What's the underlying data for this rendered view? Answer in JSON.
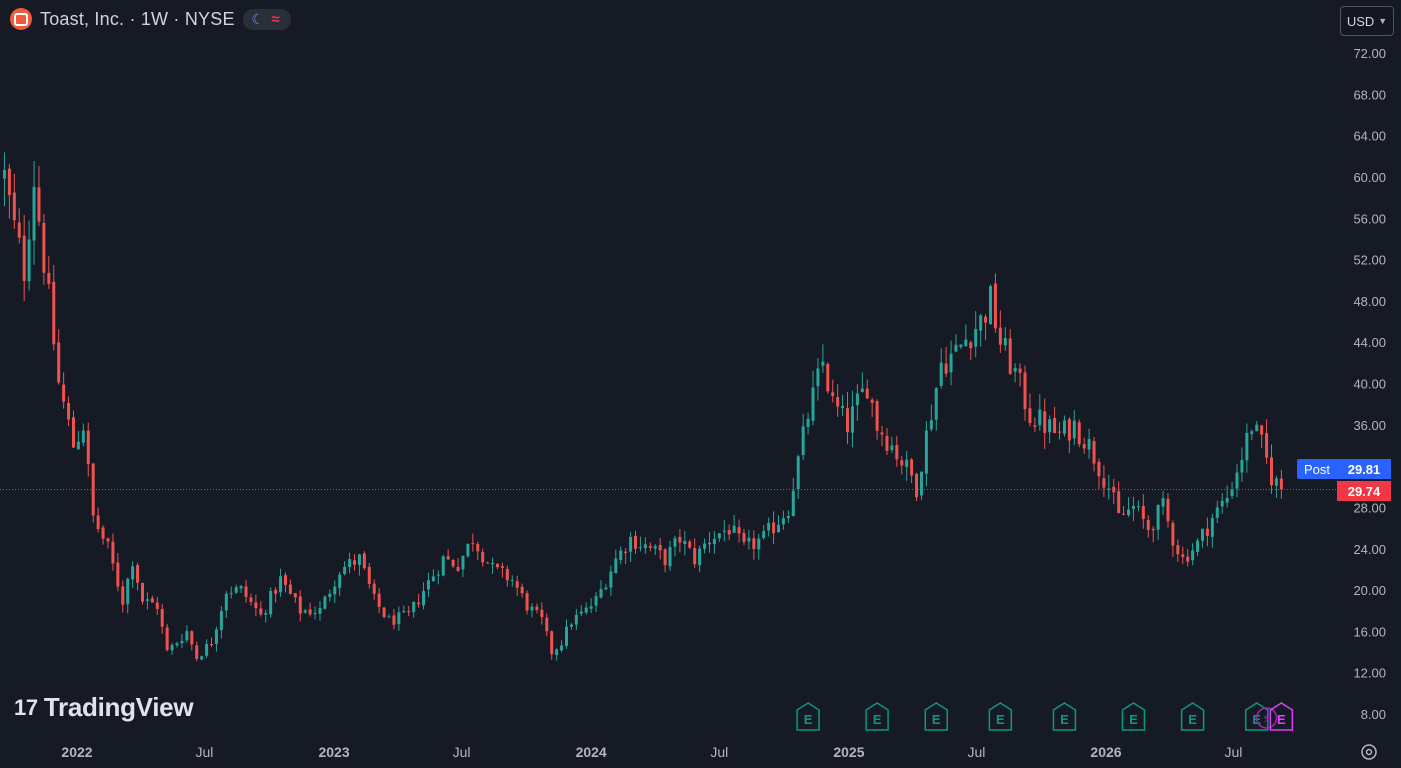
{
  "header": {
    "title": "Toast, Inc. · 1W · NYSE",
    "logo_icon": "toast-logo-icon",
    "moon_icon": "moon-icon",
    "wave_icon": "wave-icon"
  },
  "currency": {
    "label": "USD",
    "chevron_icon": "chevron-down-icon"
  },
  "price_labels": {
    "post_label": "Post",
    "post_value": "29.81",
    "last_value": "29.74"
  },
  "watermark": {
    "text": "TradingView",
    "logo_glyph": "17"
  },
  "colors": {
    "background": "#161a25",
    "up": "#26a69a",
    "down": "#ef5350",
    "post": "#2962ff",
    "last": "#f23645",
    "earnings": "#089981",
    "split": "#9c27b0",
    "dividend": "#e040fb"
  },
  "chart_data": {
    "type": "candlestick",
    "timeframe": "1W",
    "y_axis": {
      "min": 8,
      "max": 72,
      "ticks": [
        8,
        12,
        16,
        20,
        24,
        28,
        32,
        36,
        40,
        44,
        48,
        52,
        56,
        60,
        64,
        68,
        72
      ],
      "tick_labels": [
        "8.00",
        "12.00",
        "16.00",
        "20.00",
        "24.00",
        "28.00",
        "",
        "36.00",
        "40.00",
        "44.00",
        "48.00",
        "52.00",
        "56.00",
        "60.00",
        "64.00",
        "68.00",
        "72.00"
      ]
    },
    "x_axis": {
      "labels": [
        "2022",
        "Jul",
        "2023",
        "Jul",
        "2024",
        "Jul",
        "2025",
        "Jul",
        "2026",
        "Jul"
      ],
      "start": "2021-09-20",
      "end": "2026-09-14"
    },
    "last_price": 29.74,
    "post_price": 29.81,
    "anchors": [
      [
        "2021-09-20",
        60
      ],
      [
        "2021-10-04",
        55
      ],
      [
        "2021-10-18",
        51
      ],
      [
        "2021-11-01",
        60
      ],
      [
        "2021-11-15",
        52
      ],
      [
        "2021-12-06",
        40
      ],
      [
        "2021-12-27",
        34
      ],
      [
        "2022-01-10",
        36
      ],
      [
        "2022-01-24",
        27
      ],
      [
        "2022-02-14",
        24
      ],
      [
        "2022-03-07",
        19
      ],
      [
        "2022-03-21",
        23
      ],
      [
        "2022-04-04",
        19
      ],
      [
        "2022-04-25",
        18.5
      ],
      [
        "2022-05-09",
        14
      ],
      [
        "2022-05-23",
        15
      ],
      [
        "2022-06-06",
        16
      ],
      [
        "2022-06-20",
        13.5
      ],
      [
        "2022-07-11",
        15
      ],
      [
        "2022-08-01",
        20
      ],
      [
        "2022-08-22",
        20
      ],
      [
        "2022-09-19",
        17.5
      ],
      [
        "2022-10-17",
        21
      ],
      [
        "2022-11-14",
        18
      ],
      [
        "2022-12-12",
        18
      ],
      [
        "2023-01-09",
        22
      ],
      [
        "2023-02-06",
        23
      ],
      [
        "2023-02-27",
        19
      ],
      [
        "2023-03-20",
        17
      ],
      [
        "2023-04-17",
        17.5
      ],
      [
        "2023-05-08",
        20
      ],
      [
        "2023-06-05",
        23
      ],
      [
        "2023-06-26",
        22.5
      ],
      [
        "2023-07-17",
        25
      ],
      [
        "2023-08-14",
        22
      ],
      [
        "2023-09-11",
        21
      ],
      [
        "2023-10-02",
        18.5
      ],
      [
        "2023-10-23",
        17
      ],
      [
        "2023-11-06",
        14
      ],
      [
        "2023-11-20",
        15
      ],
      [
        "2023-12-04",
        17
      ],
      [
        "2023-12-25",
        18
      ],
      [
        "2024-01-08",
        19
      ],
      [
        "2024-02-05",
        23
      ],
      [
        "2024-02-26",
        25
      ],
      [
        "2024-03-25",
        24
      ],
      [
        "2024-04-15",
        23
      ],
      [
        "2024-05-06",
        25
      ],
      [
        "2024-05-27",
        23
      ],
      [
        "2024-06-17",
        25
      ],
      [
        "2024-07-15",
        26
      ],
      [
        "2024-08-05",
        24
      ],
      [
        "2024-09-02",
        25
      ],
      [
        "2024-10-07",
        28
      ],
      [
        "2024-11-04",
        37
      ],
      [
        "2024-11-25",
        42
      ],
      [
        "2024-12-09",
        38
      ],
      [
        "2024-12-30",
        36
      ],
      [
        "2025-01-27",
        40
      ],
      [
        "2025-02-10",
        36
      ],
      [
        "2025-03-03",
        34
      ],
      [
        "2025-03-31",
        31
      ],
      [
        "2025-04-07",
        30
      ],
      [
        "2025-04-21",
        35
      ],
      [
        "2025-05-12",
        42
      ],
      [
        "2025-06-02",
        43
      ],
      [
        "2025-06-23",
        45
      ],
      [
        "2025-07-07",
        46
      ],
      [
        "2025-07-21",
        48
      ],
      [
        "2025-08-04",
        44
      ],
      [
        "2025-08-25",
        41
      ],
      [
        "2025-09-15",
        37
      ],
      [
        "2025-10-06",
        36
      ],
      [
        "2025-10-27",
        35
      ],
      [
        "2025-11-17",
        36
      ],
      [
        "2025-12-08",
        34
      ],
      [
        "2026-01-05",
        30
      ],
      [
        "2026-01-19",
        27
      ],
      [
        "2026-02-09",
        28
      ],
      [
        "2026-03-02",
        26
      ],
      [
        "2026-03-23",
        28
      ],
      [
        "2026-04-06",
        25
      ],
      [
        "2026-04-20",
        23
      ],
      [
        "2026-05-11",
        24.5
      ],
      [
        "2026-06-01",
        27
      ],
      [
        "2026-06-22",
        29
      ],
      [
        "2026-07-13",
        33
      ],
      [
        "2026-07-27",
        36
      ],
      [
        "2026-08-10",
        34
      ],
      [
        "2026-08-24",
        31
      ],
      [
        "2026-09-07",
        29.74
      ]
    ],
    "event_markers": [
      {
        "type": "earnings",
        "label": "E",
        "date": "2024-11-04"
      },
      {
        "type": "earnings",
        "label": "E",
        "date": "2025-02-10"
      },
      {
        "type": "earnings",
        "label": "E",
        "date": "2025-05-05"
      },
      {
        "type": "earnings",
        "label": "E",
        "date": "2025-08-04"
      },
      {
        "type": "earnings",
        "label": "E",
        "date": "2025-11-03"
      },
      {
        "type": "earnings",
        "label": "E",
        "date": "2026-02-09"
      },
      {
        "type": "earnings",
        "label": "E",
        "date": "2026-05-04"
      },
      {
        "type": "earnings",
        "label": "E",
        "date": "2026-08-03"
      },
      {
        "type": "split",
        "label": "⚡",
        "date": "2026-08-17"
      },
      {
        "type": "dividend",
        "label": "E",
        "date": "2026-09-07"
      }
    ]
  }
}
